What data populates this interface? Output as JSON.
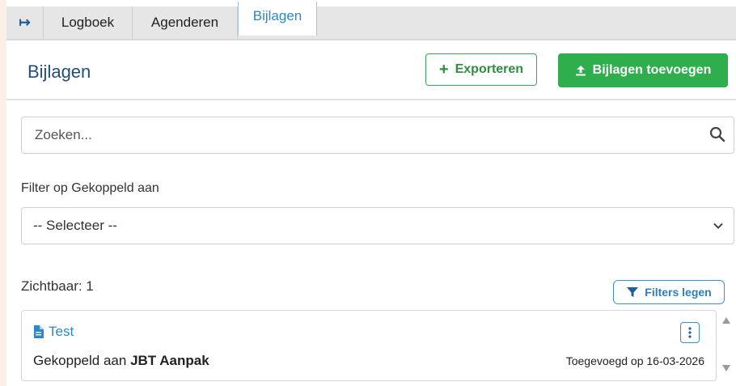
{
  "tabs": {
    "collapse_glyph": "↦",
    "items": [
      {
        "label": "Logboek"
      },
      {
        "label": "Agenderen"
      },
      {
        "label": "Bijlagen"
      }
    ],
    "active": "Bijlagen"
  },
  "header": {
    "title": "Bijlagen",
    "export_label": "Exporteren",
    "upload_label": "Bijlagen toevoegen"
  },
  "search": {
    "placeholder": "Zoeken...",
    "value": ""
  },
  "filter": {
    "label": "Filter op Gekoppeld aan",
    "selected": "-- Selecteer --"
  },
  "results": {
    "visible_text": "Zichtbaar: 1",
    "clear_filters_label": "Filters legen"
  },
  "items": [
    {
      "title": "Test",
      "linked_prefix": "Gekoppeld aan",
      "linked_to": "JBT Aanpak",
      "added": "Toegevoegd op 16-03-2026"
    }
  ],
  "colors": {
    "accent": "#2f86c9",
    "success": "#2fae4e",
    "title": "#1f4f7a"
  }
}
